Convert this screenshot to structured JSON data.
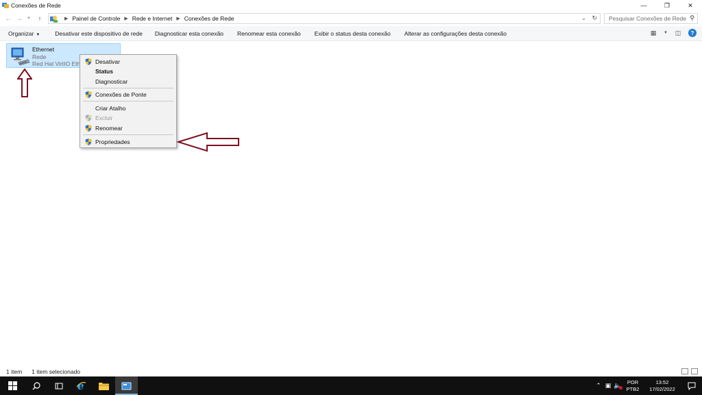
{
  "window": {
    "title": "Conexões de Rede",
    "controls": [
      "minimize",
      "maximize",
      "close"
    ]
  },
  "address": {
    "breadcrumbs": [
      "Painel de Controle",
      "Rede e Internet",
      "Conexões de Rede"
    ],
    "search_placeholder": "Pesquisar Conexões de Rede"
  },
  "toolbar": {
    "organize": "Organizar",
    "commands": [
      "Desativar este dispositivo de rede",
      "Diagnosticar esta conexão",
      "Renomear esta conexão",
      "Exibir o status desta conexão",
      "Alterar as configurações desta conexão"
    ]
  },
  "connection": {
    "name": "Ethernet",
    "network": "Rede",
    "device": "Red Hat VirtIO Ethernet Adapter"
  },
  "context_menu": {
    "items": [
      {
        "label": "Desativar",
        "shield": true,
        "bold": false,
        "disabled": false
      },
      {
        "label": "Status",
        "shield": false,
        "bold": true,
        "disabled": false
      },
      {
        "label": "Diagnosticar",
        "shield": false,
        "bold": false,
        "disabled": false
      },
      {
        "label": "Conexões de Ponte",
        "shield": true,
        "bold": false,
        "disabled": false
      },
      {
        "label": "Criar Atalho",
        "shield": false,
        "bold": false,
        "disabled": false
      },
      {
        "label": "Excluir",
        "shield": true,
        "bold": false,
        "disabled": true
      },
      {
        "label": "Renomear",
        "shield": true,
        "bold": false,
        "disabled": false
      },
      {
        "label": "Propriedades",
        "shield": true,
        "bold": false,
        "disabled": false
      }
    ]
  },
  "status": {
    "count": "1 item",
    "selected": "1 item selecionado"
  },
  "taskbar": {
    "language": "POR",
    "layout": "PTB2",
    "time": "13:52",
    "date": "17/02/2022"
  },
  "colors": {
    "selection_bg": "#cce8ff",
    "annotation_arrow": "#7b1020",
    "taskbar_bg": "#101010"
  }
}
